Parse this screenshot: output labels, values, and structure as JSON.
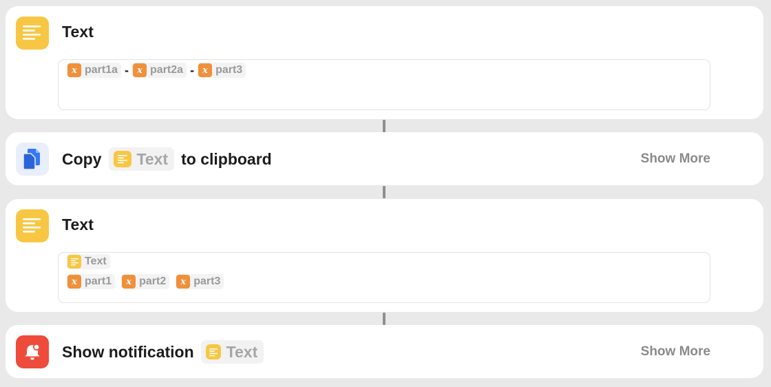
{
  "actions": {
    "text1": {
      "title": "Text",
      "tokens": [
        "part1a",
        "part2a",
        "part3"
      ],
      "separator": "-"
    },
    "copy": {
      "verb": "Copy",
      "pill": "Text",
      "suffix": "to clipboard",
      "show_more": "Show More"
    },
    "text2": {
      "title": "Text",
      "line1_token": "Text",
      "tokens": [
        "part1",
        "part2",
        "part3"
      ]
    },
    "notification": {
      "verb": "Show notification",
      "pill": "Text",
      "show_more": "Show More"
    }
  },
  "icons": {
    "text": "text-lines-icon",
    "copy": "document-copy-icon",
    "notification": "bell-badge-icon",
    "variable": "variable-x-icon"
  },
  "colors": {
    "text_icon": "#f7c744",
    "variable_icon": "#f0903a",
    "notification_icon": "#ee4b3b",
    "copy_icon": "#3478f6"
  }
}
